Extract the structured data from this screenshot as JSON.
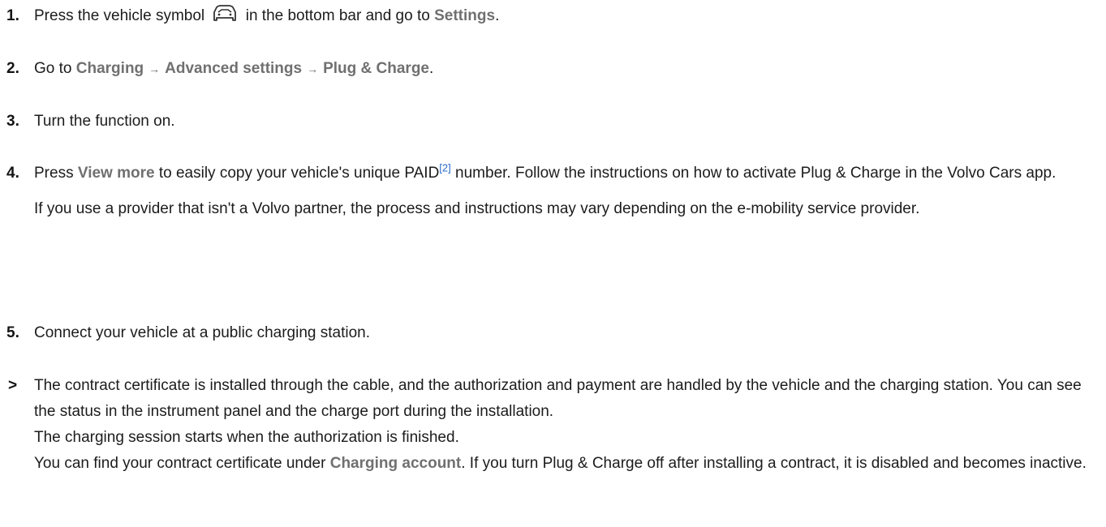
{
  "steps": [
    {
      "number": "1.",
      "t1": "Press the vehicle symbol",
      "icon": "car-icon",
      "t2": "in the bottom bar and go to",
      "ui1": "Settings",
      "t3": "."
    },
    {
      "number": "2.",
      "t1": "Go to",
      "ui1": "Charging",
      "arrow1": "→",
      "ui2": "Advanced settings",
      "arrow2": "→",
      "ui3": "Plug & Charge",
      "t2": "."
    },
    {
      "number": "3.",
      "t1": "Turn the function on."
    },
    {
      "number": "4.",
      "t1": "Press",
      "ui1": "View more",
      "t2": "to easily copy your vehicle's unique PAID",
      "footnote": "[2]",
      "t3": "number. Follow the instructions on how to activate Plug & Charge in the Volvo Cars app.",
      "note": "If you use a provider that isn't a Volvo partner, the process and instructions may vary depending on the e-mobility service provider."
    },
    {
      "number": "5.",
      "t1": "Connect your vehicle at a public charging station."
    }
  ],
  "result": {
    "marker": ">",
    "line1": "The contract certificate is installed through the cable, and the authorization and payment are handled by the vehicle and the charging station. You can see the status in the instrument panel and the charge port during the installation.",
    "line2": "The charging session starts when the authorization is finished.",
    "line3a": "You can find your contract certificate under",
    "ui1": "Charging account",
    "line3b": ". If you turn Plug & Charge off after installing a contract, it is disabled and becomes inactive."
  }
}
